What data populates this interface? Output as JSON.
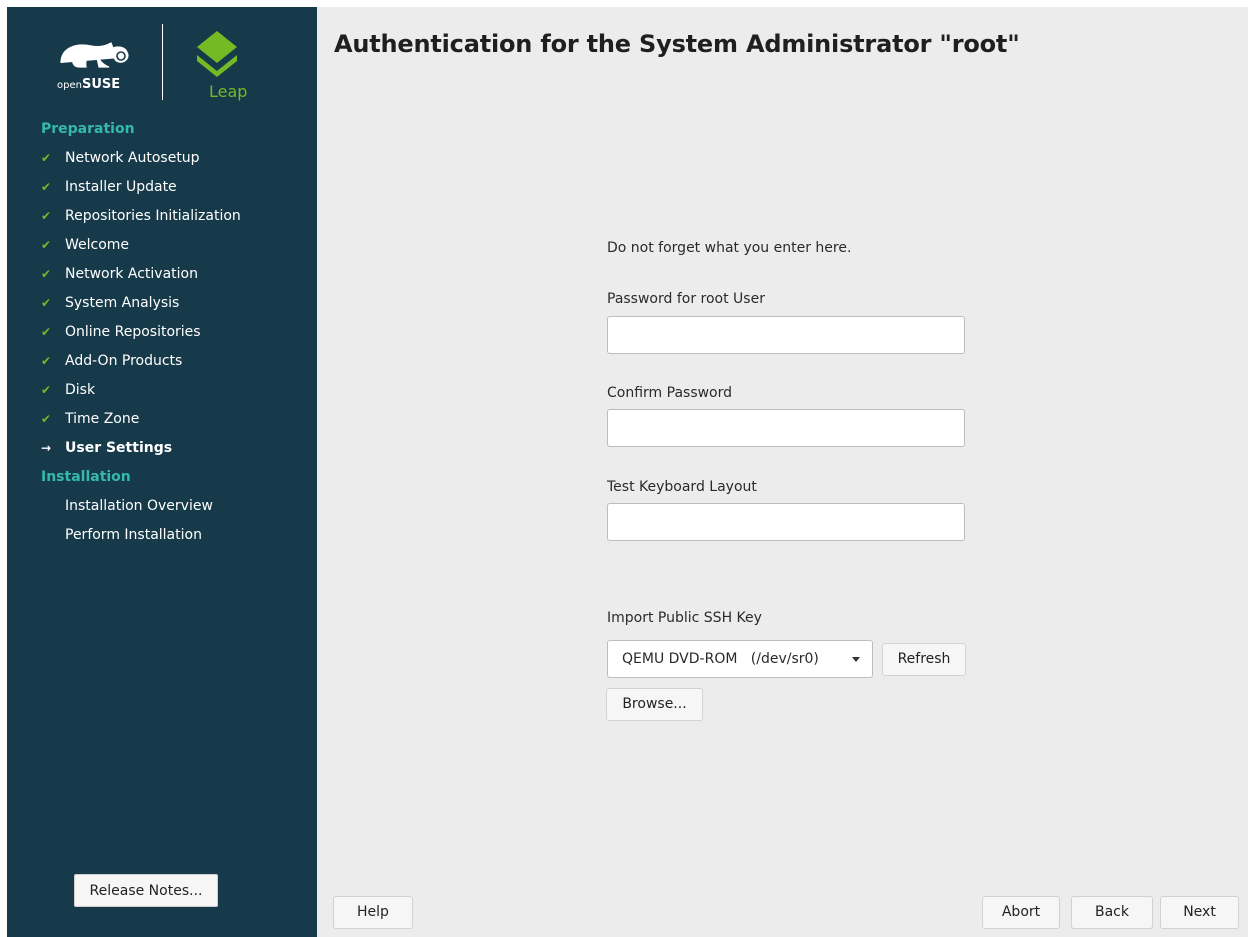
{
  "sidebar": {
    "logo_text": "openSUSE",
    "leap_text": "Leap",
    "sections": [
      {
        "title": "Preparation",
        "steps": [
          {
            "label": "Network Autosetup",
            "status": "done"
          },
          {
            "label": "Installer Update",
            "status": "done"
          },
          {
            "label": "Repositories Initialization",
            "status": "done"
          },
          {
            "label": "Welcome",
            "status": "done"
          },
          {
            "label": "Network Activation",
            "status": "done"
          },
          {
            "label": "System Analysis",
            "status": "done"
          },
          {
            "label": "Online Repositories",
            "status": "done"
          },
          {
            "label": "Add-On Products",
            "status": "done"
          },
          {
            "label": "Disk",
            "status": "done"
          },
          {
            "label": "Time Zone",
            "status": "done"
          },
          {
            "label": "User Settings",
            "status": "current"
          }
        ]
      },
      {
        "title": "Installation",
        "steps": [
          {
            "label": "Installation Overview",
            "status": "pending"
          },
          {
            "label": "Perform Installation",
            "status": "pending"
          }
        ]
      }
    ],
    "release_notes_button": "Release Notes..."
  },
  "main": {
    "title": "Authentication for the System Administrator \"root\"",
    "hint": "Do not forget what you enter here.",
    "password_label": "Password for root User",
    "password_value": "",
    "confirm_label": "Confirm Password",
    "confirm_value": "",
    "keyboard_test_label": "Test Keyboard Layout",
    "keyboard_test_value": "",
    "ssh_key_label": "Import Public SSH Key",
    "ssh_device_selected": "QEMU DVD-ROM   (/dev/sr0)",
    "refresh_button": "Refresh",
    "browse_button": "Browse..."
  },
  "footer": {
    "help_button": "Help",
    "abort_button": "Abort",
    "back_button": "Back",
    "next_button": "Next"
  },
  "colors": {
    "sidebar_bg": "#173a4a",
    "section_title": "#35b9ab",
    "check_mark": "#73ba25",
    "main_bg": "#ececec"
  },
  "icons": {
    "done": "check-icon",
    "current": "arrow-right-icon"
  }
}
